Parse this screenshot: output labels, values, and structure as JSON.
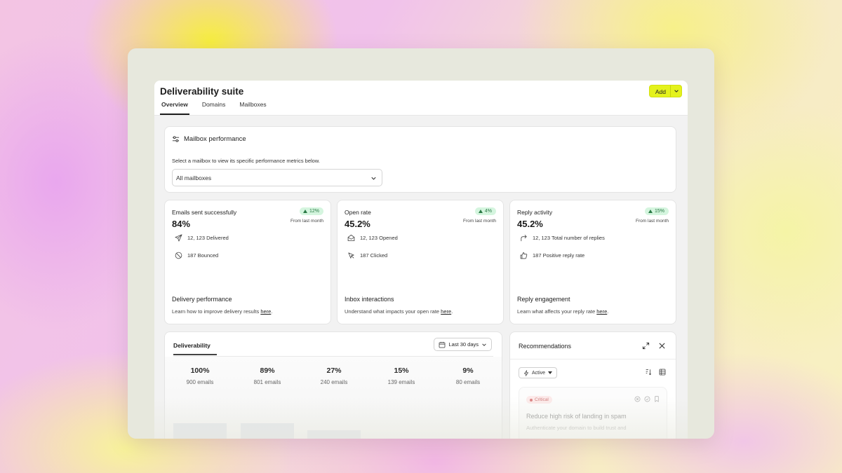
{
  "app": {
    "title": "Deliverability suite",
    "add_label": "Add"
  },
  "tabs": [
    {
      "label": "Overview",
      "active": true
    },
    {
      "label": "Domains",
      "active": false
    },
    {
      "label": "Mailboxes",
      "active": false
    }
  ],
  "mailbox_performance": {
    "title": "Mailbox performance",
    "description": "Select a mailbox to view its specific performance metrics below.",
    "selected": "All mailboxes"
  },
  "metrics": [
    {
      "label": "Emails sent successfully",
      "value": "84%",
      "change": "12%",
      "change_note": "From last month",
      "rows": [
        {
          "icon": "send-icon",
          "text": "12, 123 Delivered"
        },
        {
          "icon": "block-icon",
          "text": "187 Bounced"
        }
      ],
      "footer_title": "Delivery performance",
      "footer_text": "Learn how to improve delivery results ",
      "footer_link": "here",
      "footer_end": "."
    },
    {
      "label": "Open rate",
      "value": "45.2%",
      "change": "4%",
      "change_note": "From last month",
      "rows": [
        {
          "icon": "envelope-open-icon",
          "text": "12, 123 Opened"
        },
        {
          "icon": "cursor-icon",
          "text": "187 Clicked"
        }
      ],
      "footer_title": "Inbox interactions",
      "footer_text": "Understand what impacts your open rate ",
      "footer_link": "here",
      "footer_end": "."
    },
    {
      "label": "Reply activity",
      "value": "45.2%",
      "change": "15%",
      "change_note": "From last month",
      "rows": [
        {
          "icon": "reply-arrow-icon",
          "text": "12, 123 Total number of replies"
        },
        {
          "icon": "thumbs-up-icon",
          "text": "187 Positive reply rate"
        }
      ],
      "footer_title": "Reply engagement",
      "footer_text": "Learn what affects your reply rate ",
      "footer_link": "here",
      "footer_end": "."
    }
  ],
  "deliverability": {
    "tab": "Deliverability",
    "range": "Last 30 days",
    "funnel": [
      {
        "pct": "100%",
        "emails": "900 emails",
        "fill": 1.0
      },
      {
        "pct": "89%",
        "emails": "801 emails",
        "fill": 0.89
      },
      {
        "pct": "27%",
        "emails": "240 emails",
        "fill": 0.27
      },
      {
        "pct": "15%",
        "emails": "139 emails",
        "fill": 0.15
      },
      {
        "pct": "9%",
        "emails": "80 emails",
        "fill": 0.09
      }
    ]
  },
  "recommendations": {
    "title": "Recommendations",
    "filter": "Active",
    "item": {
      "severity": "Critical",
      "title": "Reduce high risk of landing in spam",
      "description": "Authenticate your domain to build trust and"
    }
  },
  "colors": {
    "accent": "#e4f21c",
    "badge_bg": "#d5f5df",
    "badge_text": "#2a7a45",
    "bar": "#8fb0e4",
    "critical": "#c05050"
  }
}
